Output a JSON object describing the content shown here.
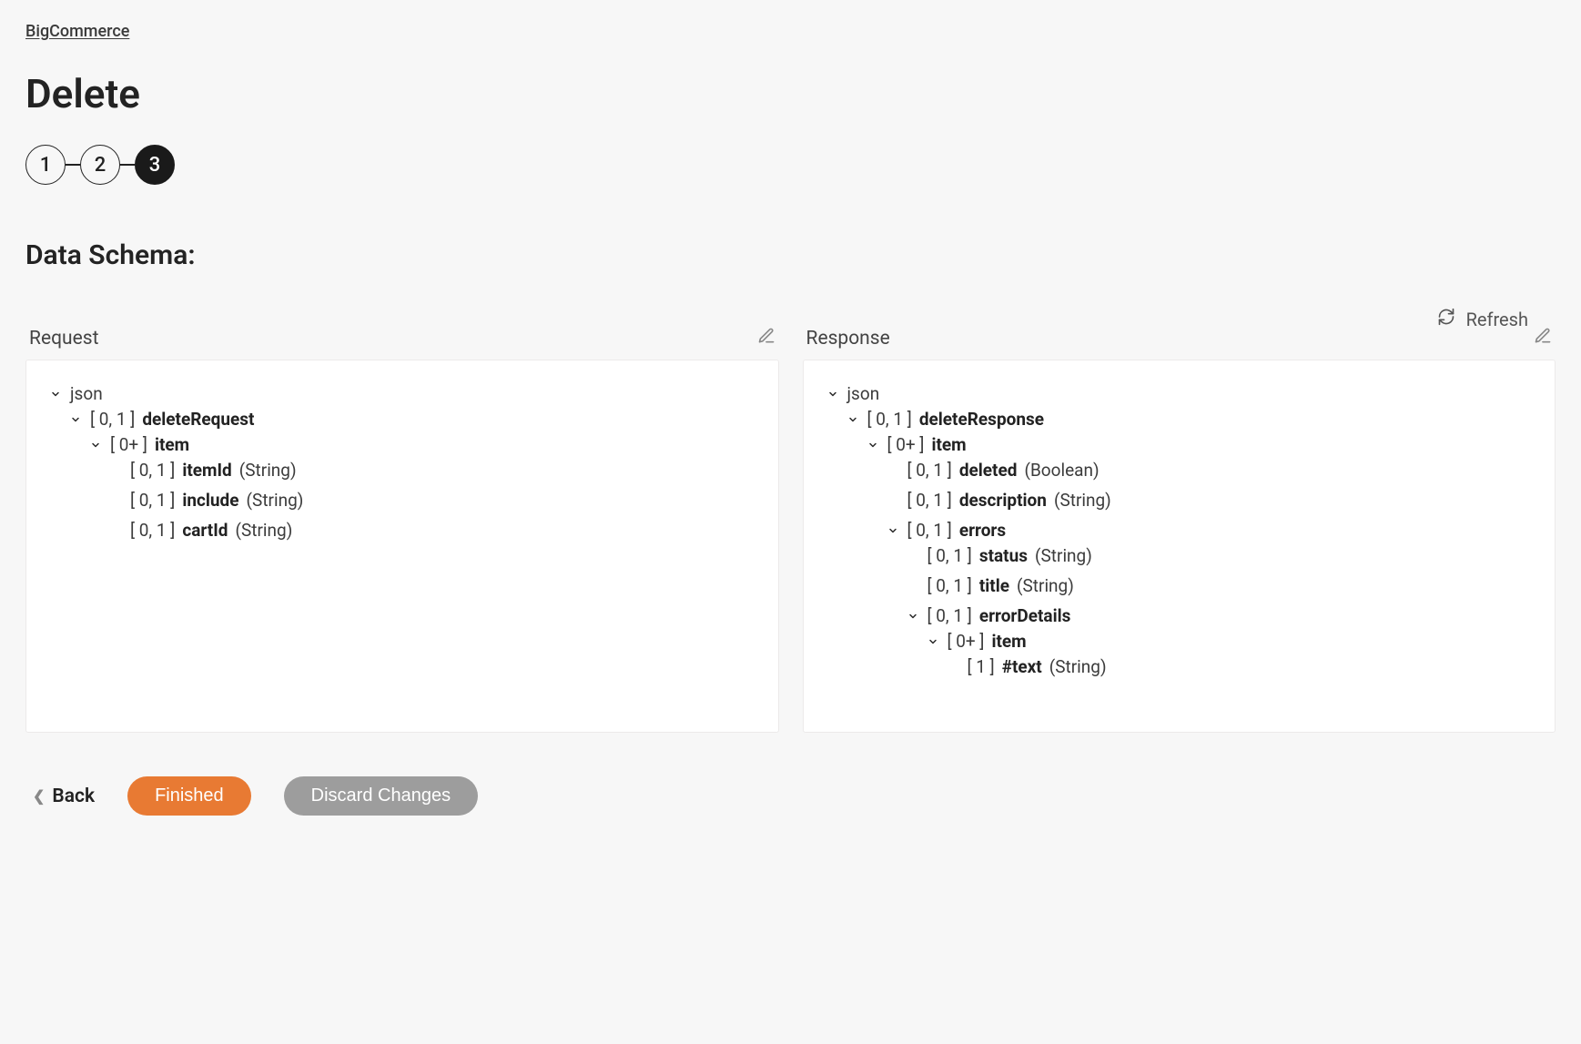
{
  "breadcrumb": "BigCommerce",
  "page_title": "Delete",
  "stepper": {
    "steps": [
      "1",
      "2",
      "3"
    ],
    "active_index": 2
  },
  "section_title": "Data Schema:",
  "refresh_label": "Refresh",
  "panels": {
    "request": {
      "title": "Request",
      "tree": {
        "name": "json",
        "children": [
          {
            "card": "[ 0, 1 ]",
            "name": "deleteRequest",
            "children": [
              {
                "card": "[ 0+ ]",
                "name": "item",
                "children": [
                  {
                    "card": "[ 0, 1 ]",
                    "name": "itemId",
                    "type": "(String)"
                  },
                  {
                    "card": "[ 0, 1 ]",
                    "name": "include",
                    "type": "(String)"
                  },
                  {
                    "card": "[ 0, 1 ]",
                    "name": "cartId",
                    "type": "(String)"
                  }
                ]
              }
            ]
          }
        ]
      }
    },
    "response": {
      "title": "Response",
      "tree": {
        "name": "json",
        "children": [
          {
            "card": "[ 0, 1 ]",
            "name": "deleteResponse",
            "children": [
              {
                "card": "[ 0+ ]",
                "name": "item",
                "children": [
                  {
                    "card": "[ 0, 1 ]",
                    "name": "deleted",
                    "type": "(Boolean)"
                  },
                  {
                    "card": "[ 0, 1 ]",
                    "name": "description",
                    "type": "(String)"
                  },
                  {
                    "card": "[ 0, 1 ]",
                    "name": "errors",
                    "children": [
                      {
                        "card": "[ 0, 1 ]",
                        "name": "status",
                        "type": "(String)"
                      },
                      {
                        "card": "[ 0, 1 ]",
                        "name": "title",
                        "type": "(String)"
                      },
                      {
                        "card": "[ 0, 1 ]",
                        "name": "errorDetails",
                        "children": [
                          {
                            "card": "[ 0+ ]",
                            "name": "item",
                            "children": [
                              {
                                "card": "[ 1 ]",
                                "name": "#text",
                                "type": "(String)"
                              }
                            ]
                          }
                        ]
                      }
                    ]
                  }
                ]
              }
            ]
          }
        ]
      }
    }
  },
  "footer": {
    "back": "Back",
    "finished": "Finished",
    "discard": "Discard Changes"
  }
}
